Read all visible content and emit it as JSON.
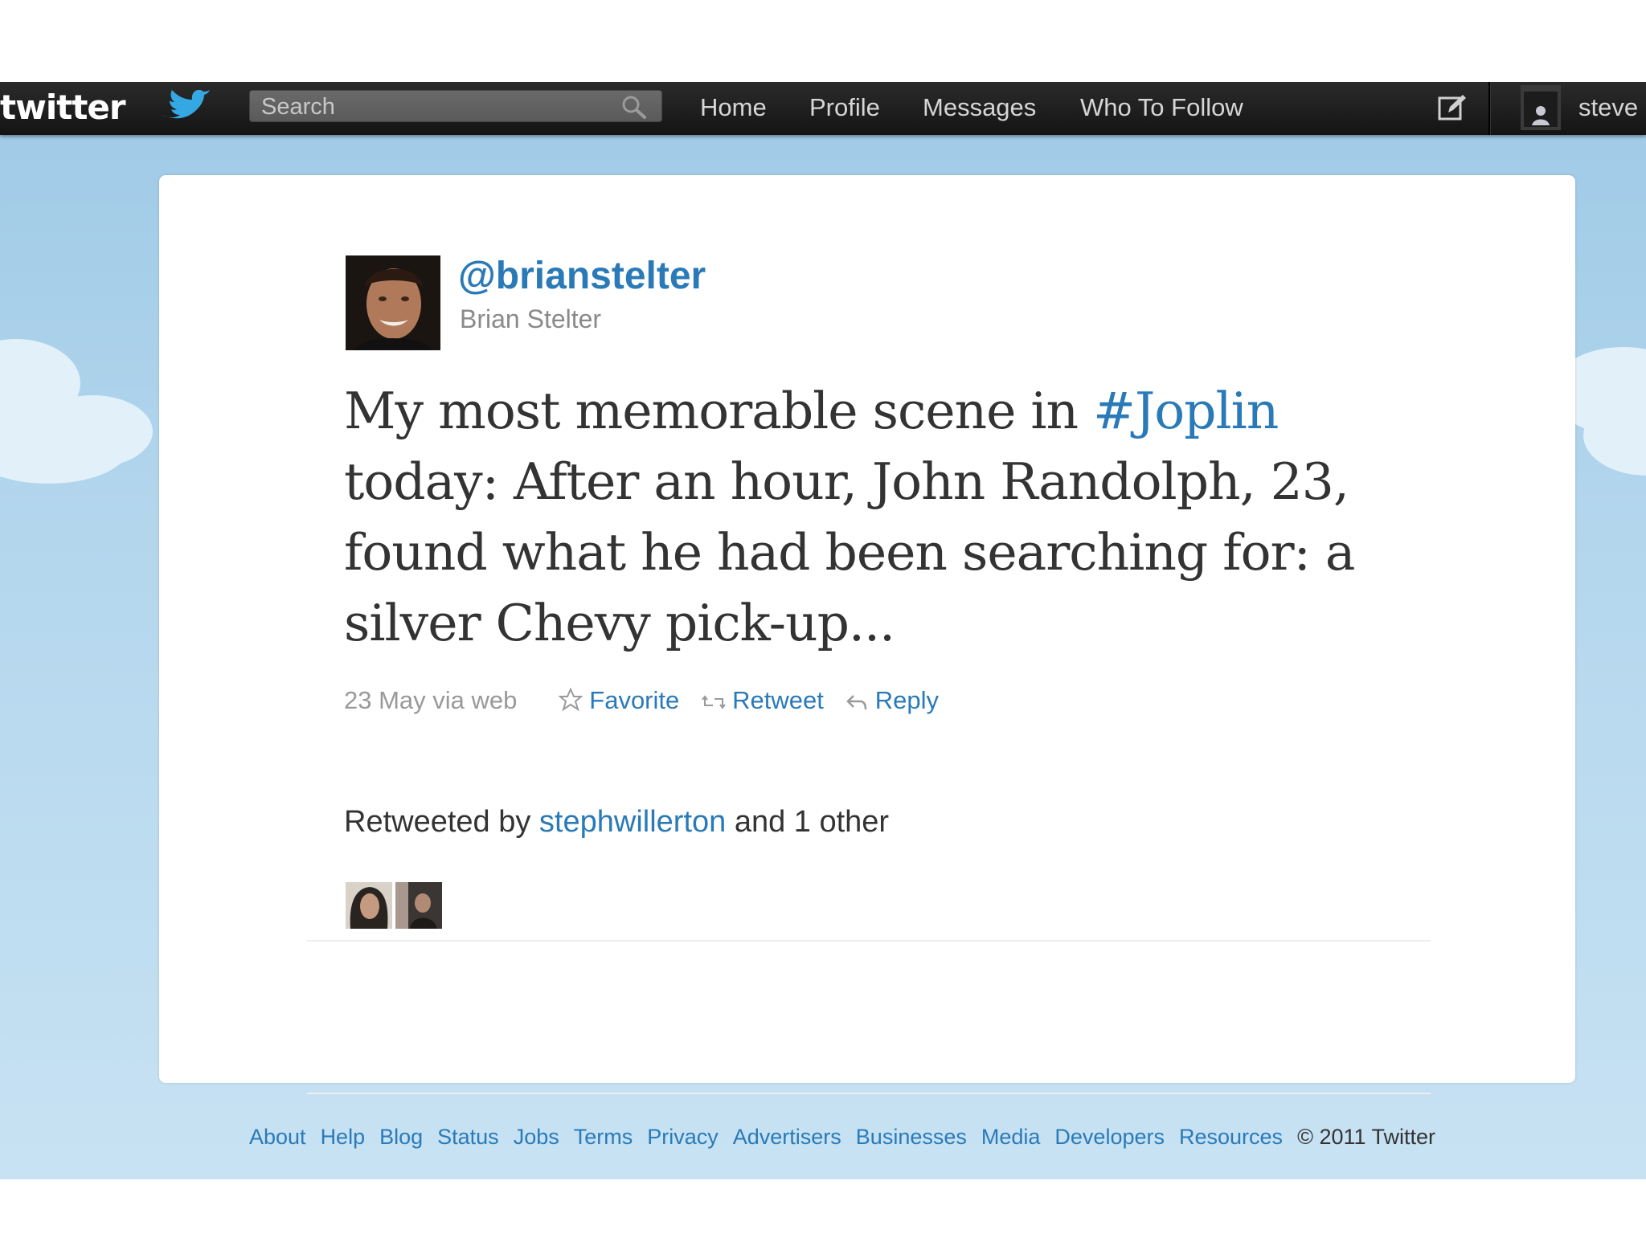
{
  "topbar": {
    "logo_text": "twitter",
    "search": {
      "placeholder": "Search",
      "value": ""
    },
    "nav": [
      "Home",
      "Profile",
      "Messages",
      "Who To Follow"
    ],
    "username": "steve"
  },
  "tweet": {
    "screen_name": "@brianstelter",
    "full_name": "Brian Stelter",
    "text_before": "My most memorable scene in ",
    "hashtag": "#Joplin",
    "text_after": " today: After an hour, John Randolph, 23, found what he had been searching for: a silver Chevy pick-up...",
    "timestamp": "23 May via web",
    "actions": {
      "favorite": "Favorite",
      "retweet": "Retweet",
      "reply": "Reply"
    },
    "retweeted_by": {
      "prefix": "Retweeted by ",
      "user": "stephwillerton",
      "suffix": " and 1 other"
    }
  },
  "footer": {
    "links": [
      "About",
      "Help",
      "Blog",
      "Status",
      "Jobs",
      "Terms",
      "Privacy",
      "Advertisers",
      "Businesses",
      "Media",
      "Developers",
      "Resources"
    ],
    "copyright": "© 2011 Twitter"
  },
  "colors": {
    "link": "#2a7ab8",
    "topbar": "#1a1a1a",
    "background": "#b3d6ed",
    "text": "#333333"
  },
  "icons": [
    "twitter-bird-icon",
    "search-icon",
    "compose-icon",
    "star-icon",
    "retweet-icon",
    "reply-icon"
  ]
}
